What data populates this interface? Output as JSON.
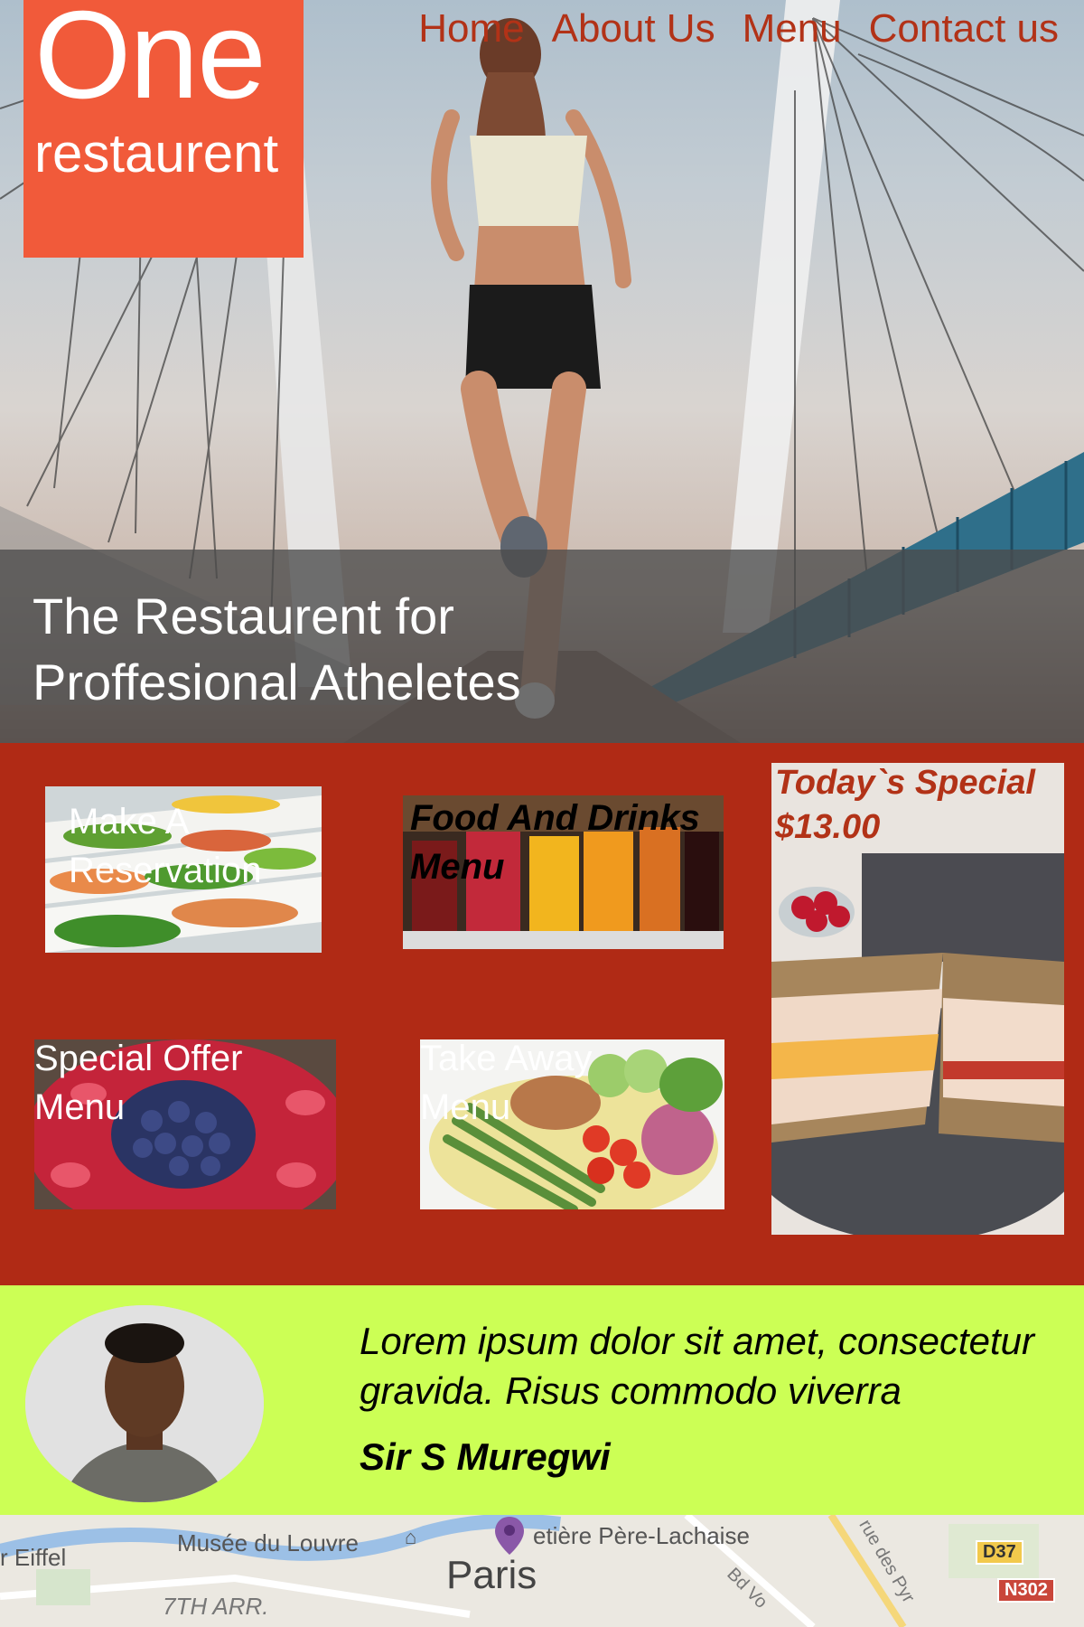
{
  "brand": {
    "name_big": "One",
    "name_small": "restaurent",
    "color": "#f15a3a"
  },
  "nav": {
    "home": "Home",
    "about": "About Us",
    "menu": "Menu",
    "contact": "Contact us"
  },
  "hero": {
    "headline_line1": "The Restaurent for",
    "headline_line2": "Proffesional Atheletes"
  },
  "tiles": {
    "reservation_line1": "Make A",
    "reservation_line2": "Reservation",
    "food_drinks_line1": "Food And Drinks",
    "food_drinks_line2": "Menu",
    "special_offer_line1": "Special Offer",
    "special_offer_line2": "Menu",
    "take_away_line1": "Take Away",
    "take_away_line2": "Menu"
  },
  "special": {
    "title": "Today`s Special",
    "price": "$13.00"
  },
  "testimonial": {
    "quote_line1": "Lorem ipsum dolor sit amet, consectetur",
    "quote_line2": "gravida. Risus commodo viverra",
    "author": "Sir S Muregwi"
  },
  "map": {
    "city": "Paris",
    "louvre": "Musée du Louvre",
    "eiffel": "r Eiffel",
    "cemetery": "etière Père-Lachaise",
    "arrondissement": "7TH ARR.",
    "street_a": "rue des Pyr",
    "street_b": "Bd Vo",
    "road_1": "D37",
    "road_2": "N302"
  },
  "colors": {
    "section_bg": "#b02a15",
    "testimonial_bg": "#ccff55",
    "nav_text": "#b23217"
  }
}
